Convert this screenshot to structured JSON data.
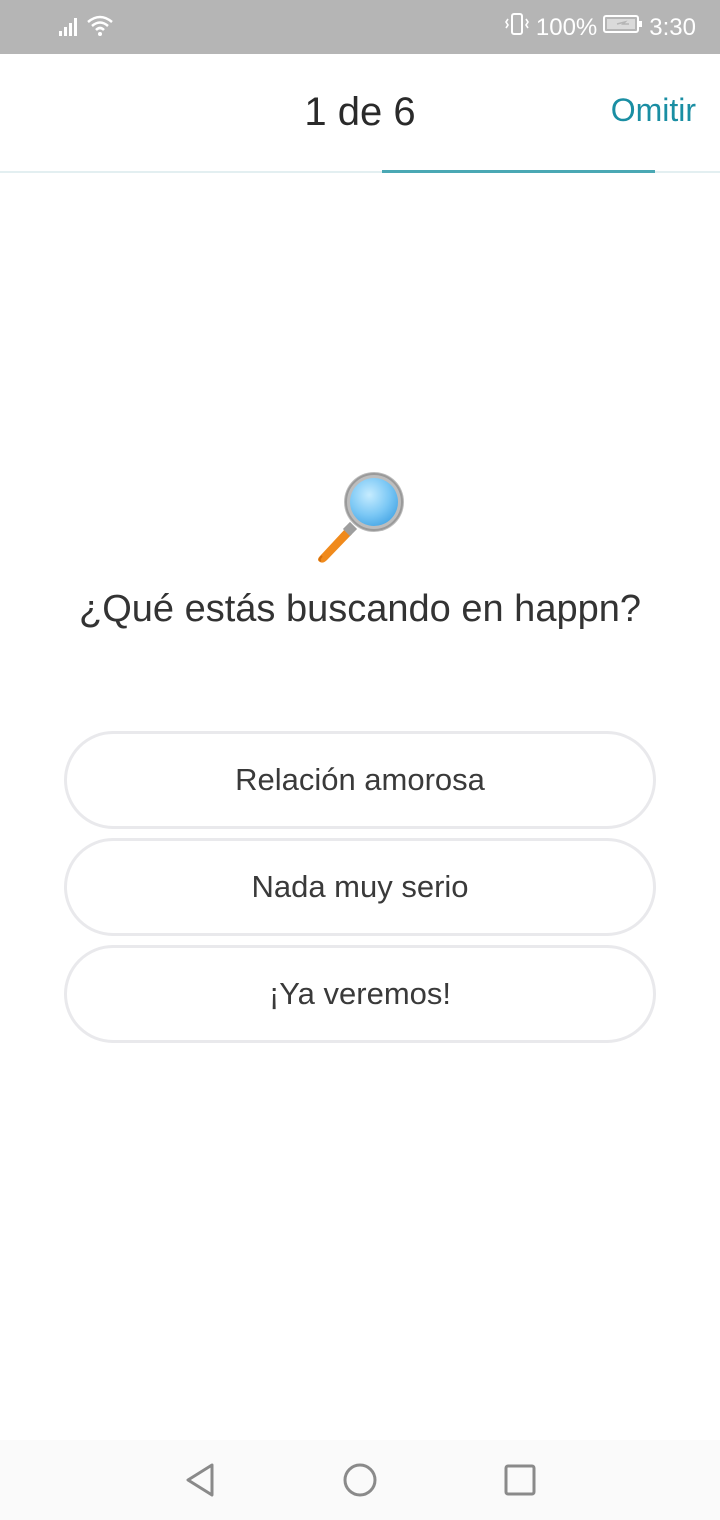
{
  "status_bar": {
    "battery": "100%",
    "time": "3:30",
    "icons": [
      "signal-icon",
      "wifi-icon",
      "vibrate-icon",
      "battery-icon"
    ]
  },
  "header": {
    "progress": "1 de 6",
    "skip_label": "Omitir",
    "progress_fraction": 0.1667
  },
  "question": {
    "icon": "magnifying-glass-icon",
    "title": "¿Qué estás buscando en happn?"
  },
  "options": [
    {
      "label": "Relación amorosa"
    },
    {
      "label": "Nada muy serio"
    },
    {
      "label": "¡Ya veremos!"
    }
  ],
  "nav": {
    "icons": [
      "back-icon",
      "home-icon",
      "recents-icon"
    ]
  },
  "colors": {
    "accent": "#1a8ea3",
    "status_bar": "#b5b5b5",
    "option_border": "#e9e9ec"
  }
}
